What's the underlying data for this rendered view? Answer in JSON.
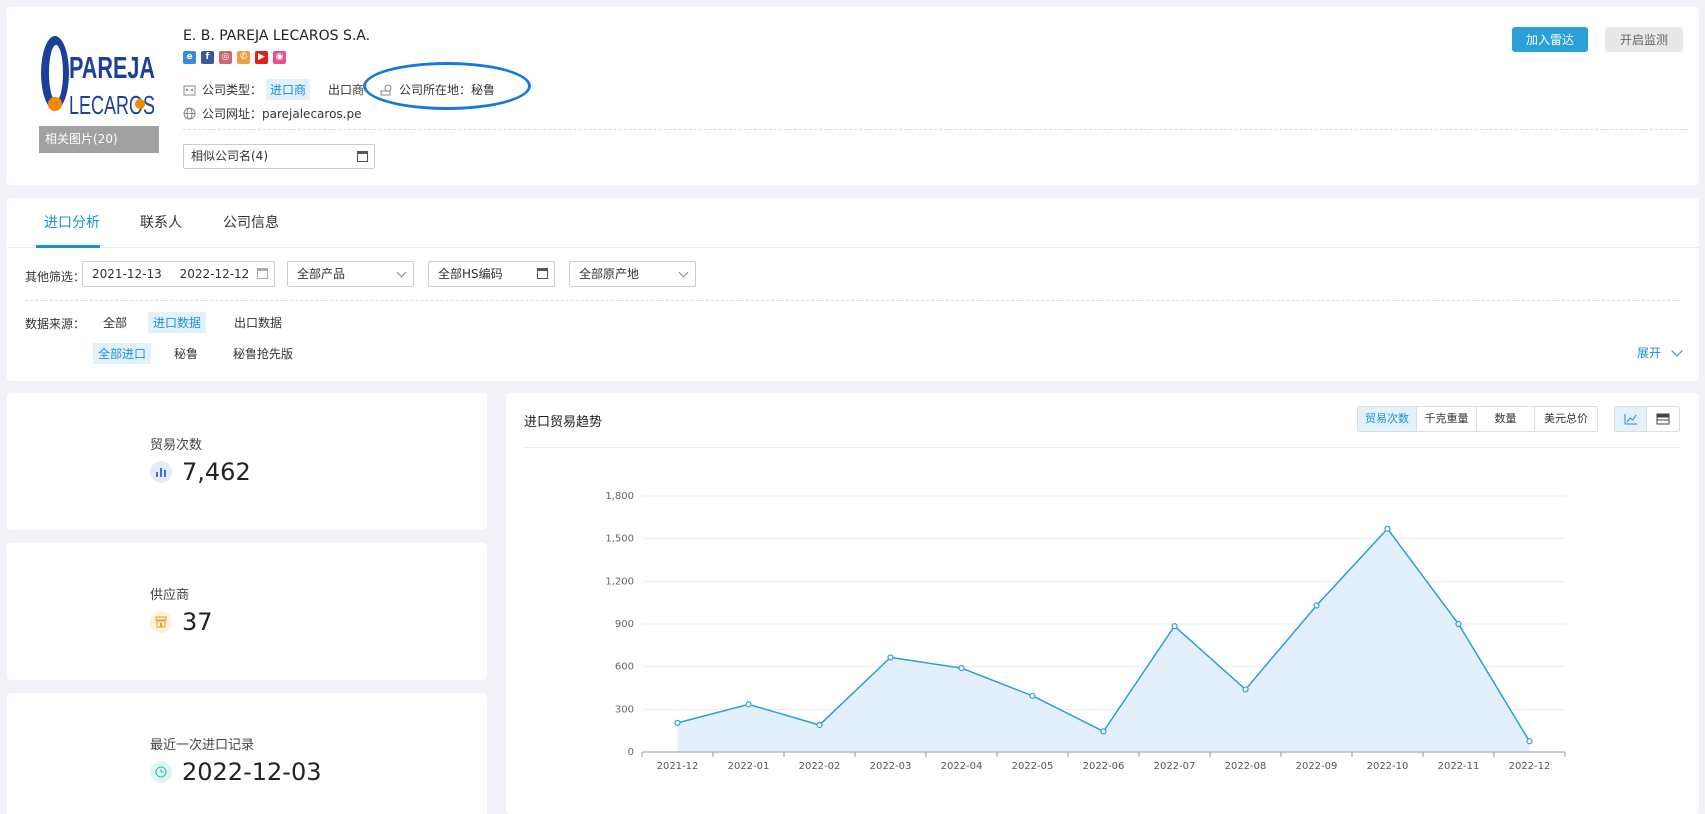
{
  "company": {
    "name": "E. B. PAREJA LECAROS S.A.",
    "logo_line1": "PAREJA",
    "logo_line2": "LECAROS",
    "logo_caption": "相关图片(20)",
    "type_label": "公司类型：",
    "type_importer": "进口商",
    "type_exporter": "出口商",
    "location_label": "公司所在地：",
    "location_value": "秘鲁",
    "website_label": "公司网址：",
    "website_value": "parejalecaros.pe",
    "similar_names": "相似公司名(4)",
    "social_icons": [
      "ie-icon",
      "facebook-icon",
      "instagram-icon",
      "phone-icon",
      "youtube-icon",
      "camera-icon"
    ]
  },
  "actions": {
    "radar": "加入雷达",
    "monitor": "开启监测"
  },
  "tabs": [
    {
      "label": "进口分析",
      "active": true
    },
    {
      "label": "联系人",
      "active": false
    },
    {
      "label": "公司信息",
      "active": false
    }
  ],
  "filters": {
    "label": "其他筛选：",
    "date_start": "2021-12-13",
    "date_end": "2022-12-12",
    "product": "全部产品",
    "hs_code": "全部HS编码",
    "origin": "全部原产地"
  },
  "source": {
    "label": "数据来源：",
    "options": [
      "全部",
      "进口数据",
      "出口数据"
    ],
    "sub_options": [
      "全部进口",
      "秘鲁",
      "秘鲁抢先版"
    ],
    "expand": "展开"
  },
  "stats": [
    {
      "label": "贸易次数",
      "value": "7,462",
      "icon": "bar-chart-icon",
      "color": "#3d6fd8"
    },
    {
      "label": "供应商",
      "value": "37",
      "icon": "supplier-icon",
      "color": "#f0a020"
    },
    {
      "label": "最近一次进口记录",
      "value": "2022-12-03",
      "icon": "clock-icon",
      "color": "#25c0b0"
    }
  ],
  "chart_header": {
    "title": "进口贸易趋势",
    "metrics": [
      "贸易次数",
      "千克重量",
      "数量",
      "美元总价"
    ],
    "active_metric": "贸易次数",
    "view_icons": [
      "line-chart-icon",
      "table-icon"
    ]
  },
  "chart_data": {
    "type": "area",
    "categories": [
      "2021-12",
      "2022-01",
      "2022-02",
      "2022-03",
      "2022-04",
      "2022-05",
      "2022-06",
      "2022-07",
      "2022-08",
      "2022-09",
      "2022-10",
      "2022-11",
      "2022-12"
    ],
    "values": [
      205,
      335,
      190,
      665,
      590,
      395,
      145,
      885,
      440,
      1030,
      1570,
      900,
      75
    ],
    "ylim": [
      0,
      1800
    ],
    "yticks": [
      0,
      300,
      600,
      900,
      1200,
      1500,
      1800
    ],
    "ytick_labels": [
      "0",
      "300",
      "600",
      "900",
      "1,200",
      "1,500",
      "1,800"
    ],
    "grid": true,
    "line_color": "#2a9fd8",
    "fill_color": "#e3f0fb"
  }
}
